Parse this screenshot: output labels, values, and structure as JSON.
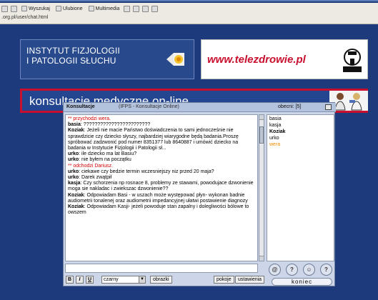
{
  "browser": {
    "toolbar_items": [
      "Wyszukaj",
      "Ulubione",
      "Multimedia"
    ],
    "address": ".org.pl/user/chat.html"
  },
  "header": {
    "logo_lines": [
      "INSTYTUT FIZJOLOGII",
      "I PATOLOGII SŁUCHU"
    ],
    "url": "www.telezdrowie.pl",
    "title": "konsultacje medyczne on-line"
  },
  "chat": {
    "window_title": "Konsultacje",
    "window_subtitle": "(IFPS - Konsultacje Online)",
    "present_label": "obecni: [5]",
    "messages": [
      {
        "kind": "sys",
        "text": "** przychodzi wera."
      },
      {
        "kind": "user",
        "user": "basia",
        "text": ": ????????????????????????"
      },
      {
        "kind": "user",
        "user": "Koziak",
        "text": ": Jeżeli nie macie Państwo doświadczenia to sami jednocześnie nie sprawdzicie czy dziecko słyszy, najbardziej wiarygodne będą badania.Proszę spróbować zadzwonić pod numer 8351377 lub 8640887 i umówić dziecko na badania w Instytucie Fizjologii i Patologii sł..."
      },
      {
        "kind": "user",
        "user": "urko",
        "text": ": ile dziecko ma lat Basiu?"
      },
      {
        "kind": "user",
        "user": "urko",
        "text": ": nie byłem na początku"
      },
      {
        "kind": "sys",
        "text": "** odchodzi Dariusz."
      },
      {
        "kind": "user",
        "user": "urko",
        "text": ": ciekawe czy bedzie termin wczesniejszy niz przed 20 maja?"
      },
      {
        "kind": "user",
        "user": "urko",
        "text": ": Darek zwątpił"
      },
      {
        "kind": "user",
        "user": "kasja",
        "text": ": Czy schorzenia np rosnace 8, problemy ze stawami, powodujace dzwonienie moga sie nakladac i zwiekszac dzwonienie??"
      },
      {
        "kind": "user",
        "user": "Koziak",
        "text": ": Odpowiadam Basi - w uszach może występować płyn- wykonan badnie audiometrii tonalenej oraz audiometrii impedancyjnej ułatwi postawienie diagnozy"
      },
      {
        "kind": "user",
        "user": "Koziak",
        "text": ": Odpowiadam Kasji- jeżeli powoduje stan zapalny i dolegliwości bólowe to owszem"
      }
    ],
    "users": [
      {
        "name": "basia",
        "style": "normal"
      },
      {
        "name": "kasja",
        "style": "normal"
      },
      {
        "name": "Koziak",
        "style": "bold"
      },
      {
        "name": "urko",
        "style": "normal"
      },
      {
        "name": "wera",
        "style": "orange"
      }
    ],
    "input_value": "",
    "format": {
      "bold": "B",
      "italic": "I",
      "underline": "U",
      "color": "czarny",
      "images": "obrazki"
    },
    "rooms_button": "pokoje",
    "settings_button": "ustawienia",
    "round_icons": [
      "@",
      "?",
      "☺",
      "?"
    ],
    "exit_button": "koniec"
  }
}
